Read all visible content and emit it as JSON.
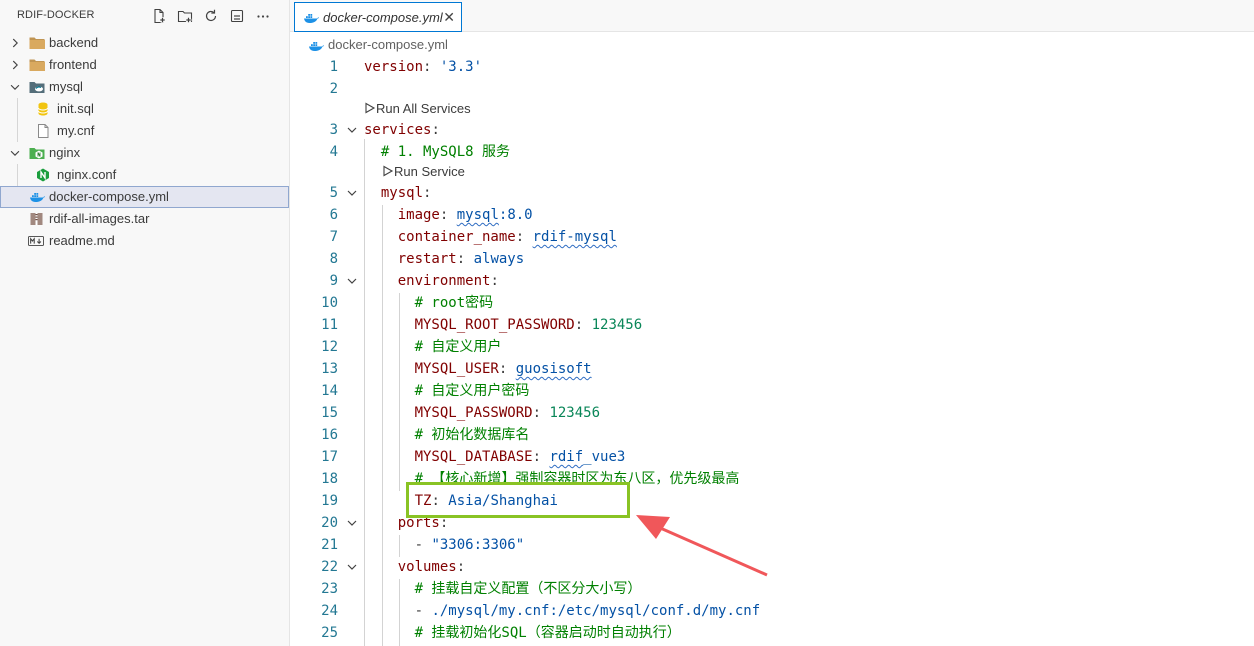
{
  "explorer": {
    "title": "RDIF-DOCKER",
    "actions": [
      "new-file-icon",
      "new-folder-icon",
      "refresh-icon",
      "collapse-all-icon",
      "more-icon"
    ],
    "items": [
      {
        "label": "backend",
        "icon": "folder-icon",
        "type": "folder",
        "expanded": false
      },
      {
        "label": "frontend",
        "icon": "folder-icon",
        "type": "folder",
        "expanded": false
      },
      {
        "label": "mysql",
        "icon": "mysql-folder-icon",
        "type": "folder",
        "expanded": true
      },
      {
        "label": "init.sql",
        "icon": "database-file-icon",
        "type": "file"
      },
      {
        "label": "my.cnf",
        "icon": "file-icon",
        "type": "file"
      },
      {
        "label": "nginx",
        "icon": "nginx-folder-icon",
        "type": "folder",
        "expanded": true
      },
      {
        "label": "nginx.conf",
        "icon": "nginx-file-icon",
        "type": "file"
      },
      {
        "label": "docker-compose.yml",
        "icon": "docker-icon",
        "type": "file",
        "selected": true
      },
      {
        "label": "rdif-all-images.tar",
        "icon": "archive-icon",
        "type": "file"
      },
      {
        "label": "readme.md",
        "icon": "markdown-icon",
        "type": "file"
      }
    ]
  },
  "tab": {
    "label": "docker-compose.yml",
    "close": "✕"
  },
  "breadcrumb": {
    "label": "docker-compose.yml"
  },
  "codelens": {
    "run_all": "Run All Services",
    "run_service": "Run Service"
  },
  "editor": {
    "lines": [
      {
        "n": "1",
        "tokens": [
          [
            "k",
            "version"
          ],
          [
            "p",
            ": "
          ],
          [
            "s",
            "'3.3'"
          ]
        ]
      },
      {
        "n": "2",
        "tokens": []
      },
      {
        "n": "3",
        "tokens": [
          [
            "k",
            "services"
          ],
          [
            "p",
            ":"
          ]
        ],
        "fold": true
      },
      {
        "n": "4",
        "tokens": [
          [
            "p",
            "  "
          ],
          [
            "c",
            "# 1. MySQL8 服务"
          ]
        ]
      },
      {
        "n": "5",
        "tokens": [
          [
            "p",
            "  "
          ],
          [
            "k",
            "mysql"
          ],
          [
            "p",
            ":"
          ]
        ],
        "fold": true
      },
      {
        "n": "6",
        "tokens": [
          [
            "p",
            "    "
          ],
          [
            "k",
            "image"
          ],
          [
            "p",
            ": "
          ],
          [
            "sq",
            "mysql"
          ],
          [
            "s",
            ":8.0"
          ]
        ]
      },
      {
        "n": "7",
        "tokens": [
          [
            "p",
            "    "
          ],
          [
            "k",
            "container_name"
          ],
          [
            "p",
            ": "
          ],
          [
            "sq",
            "rdif-mysql"
          ]
        ]
      },
      {
        "n": "8",
        "tokens": [
          [
            "p",
            "    "
          ],
          [
            "k",
            "restart"
          ],
          [
            "p",
            ": "
          ],
          [
            "s",
            "always"
          ]
        ]
      },
      {
        "n": "9",
        "tokens": [
          [
            "p",
            "    "
          ],
          [
            "k",
            "environment"
          ],
          [
            "p",
            ":"
          ]
        ],
        "fold": true
      },
      {
        "n": "10",
        "tokens": [
          [
            "p",
            "      "
          ],
          [
            "c",
            "# root密码"
          ]
        ]
      },
      {
        "n": "11",
        "tokens": [
          [
            "p",
            "      "
          ],
          [
            "k",
            "MYSQL_ROOT_PASSWORD"
          ],
          [
            "p",
            ": "
          ],
          [
            "n",
            "123456"
          ]
        ]
      },
      {
        "n": "12",
        "tokens": [
          [
            "p",
            "      "
          ],
          [
            "c",
            "# 自定义用户"
          ]
        ]
      },
      {
        "n": "13",
        "tokens": [
          [
            "p",
            "      "
          ],
          [
            "k",
            "MYSQL_USER"
          ],
          [
            "p",
            ": "
          ],
          [
            "sq",
            "guosisoft"
          ]
        ]
      },
      {
        "n": "14",
        "tokens": [
          [
            "p",
            "      "
          ],
          [
            "c",
            "# 自定义用户密码"
          ]
        ]
      },
      {
        "n": "15",
        "tokens": [
          [
            "p",
            "      "
          ],
          [
            "k",
            "MYSQL_PASSWORD"
          ],
          [
            "p",
            ": "
          ],
          [
            "n",
            "123456"
          ]
        ]
      },
      {
        "n": "16",
        "tokens": [
          [
            "p",
            "      "
          ],
          [
            "c",
            "# 初始化数据库名"
          ]
        ]
      },
      {
        "n": "17",
        "tokens": [
          [
            "p",
            "      "
          ],
          [
            "k",
            "MYSQL_DATABASE"
          ],
          [
            "p",
            ": "
          ],
          [
            "sq",
            "rdif"
          ],
          [
            "s",
            "_vue3"
          ]
        ]
      },
      {
        "n": "18",
        "tokens": [
          [
            "p",
            "      "
          ],
          [
            "c",
            "# 【核心新增】强制容器时区为东八区，优先级最高"
          ]
        ]
      },
      {
        "n": "19",
        "tokens": [
          [
            "p",
            "      "
          ],
          [
            "k",
            "TZ"
          ],
          [
            "p",
            ": "
          ],
          [
            "s",
            "Asia/Shanghai"
          ]
        ]
      },
      {
        "n": "20",
        "tokens": [
          [
            "p",
            "    "
          ],
          [
            "k",
            "ports"
          ],
          [
            "p",
            ":"
          ]
        ],
        "fold": true
      },
      {
        "n": "21",
        "tokens": [
          [
            "p",
            "      - "
          ],
          [
            "s",
            "\"3306:3306\""
          ]
        ]
      },
      {
        "n": "22",
        "tokens": [
          [
            "p",
            "    "
          ],
          [
            "k",
            "volumes"
          ],
          [
            "p",
            ":"
          ]
        ],
        "fold": true
      },
      {
        "n": "23",
        "tokens": [
          [
            "p",
            "      "
          ],
          [
            "c",
            "# 挂载自定义配置（不区分大小写）"
          ]
        ]
      },
      {
        "n": "24",
        "tokens": [
          [
            "p",
            "      - "
          ],
          [
            "s",
            "./mysql/my.cnf:/etc/mysql/conf.d/my.cnf"
          ]
        ]
      },
      {
        "n": "25",
        "tokens": [
          [
            "p",
            "      "
          ],
          [
            "c",
            "# 挂载初始化SQL（容器启动时自动执行）"
          ]
        ]
      }
    ]
  },
  "colors": {
    "key": "#800000",
    "string": "#0451a5",
    "number": "#098658",
    "comment": "#008000",
    "line_number": "#237893",
    "highlight_box": "#89c324",
    "arrow": "#f0575a"
  }
}
